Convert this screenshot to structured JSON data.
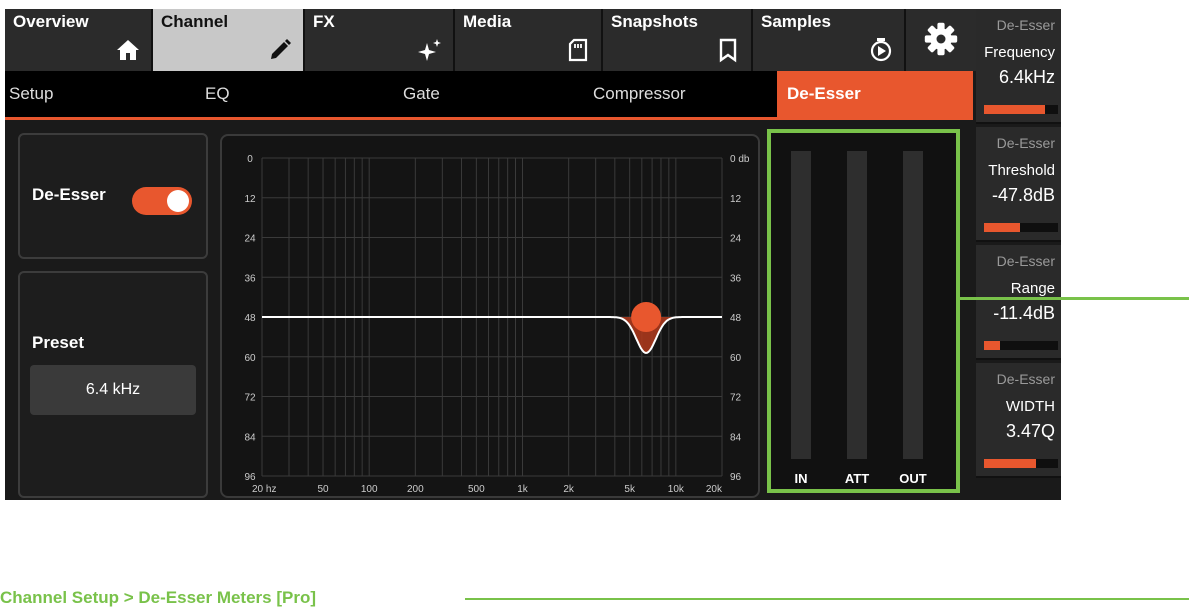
{
  "top_tabs": [
    {
      "label": "Overview",
      "icon": "home-icon"
    },
    {
      "label": "Channel",
      "icon": "pencil-icon"
    },
    {
      "label": "FX",
      "icon": "sparkle-icon"
    },
    {
      "label": "Media",
      "icon": "sd-card-icon"
    },
    {
      "label": "Snapshots",
      "icon": "bookmark-icon"
    },
    {
      "label": "Samples",
      "icon": "sample-player-icon"
    }
  ],
  "settings_icon": "gear-icon",
  "sub_tabs": [
    "Setup",
    "EQ",
    "Gate",
    "Compressor",
    "De-Esser"
  ],
  "active_sub_tab": "De-Esser",
  "deesser_toggle": {
    "label": "De-Esser",
    "on": true
  },
  "preset": {
    "label": "Preset",
    "value": "6.4 kHz"
  },
  "graph": {
    "left_scale": [
      "0",
      "12",
      "24",
      "36",
      "48",
      "60",
      "72",
      "84",
      "96"
    ],
    "right_scale": [
      "0 db",
      "12",
      "24",
      "36",
      "48",
      "60",
      "72",
      "84",
      "96"
    ],
    "freq_labels": [
      "20 hz",
      "50",
      "100",
      "200",
      "500",
      "1k",
      "2k",
      "5k",
      "10k",
      "20k"
    ],
    "node_frequency_hz": 6400
  },
  "meters": {
    "labels": [
      "IN",
      "ATT",
      "OUT"
    ]
  },
  "params": [
    {
      "category": "De-Esser",
      "name": "Frequency",
      "value": "6.4kHz",
      "level": 0.82
    },
    {
      "category": "De-Esser",
      "name": "Threshold",
      "value": "-47.8dB",
      "level": 0.48
    },
    {
      "category": "De-Esser",
      "name": "Range",
      "value": "-11.4dB",
      "level": 0.22
    },
    {
      "category": "De-Esser",
      "name": "WIDTH",
      "value": "3.47Q",
      "level": 0.7
    }
  ],
  "colors": {
    "accent": "#e8572e",
    "highlight": "#79c24a"
  },
  "caption": "Channel Setup > De-Esser Meters [Pro]"
}
